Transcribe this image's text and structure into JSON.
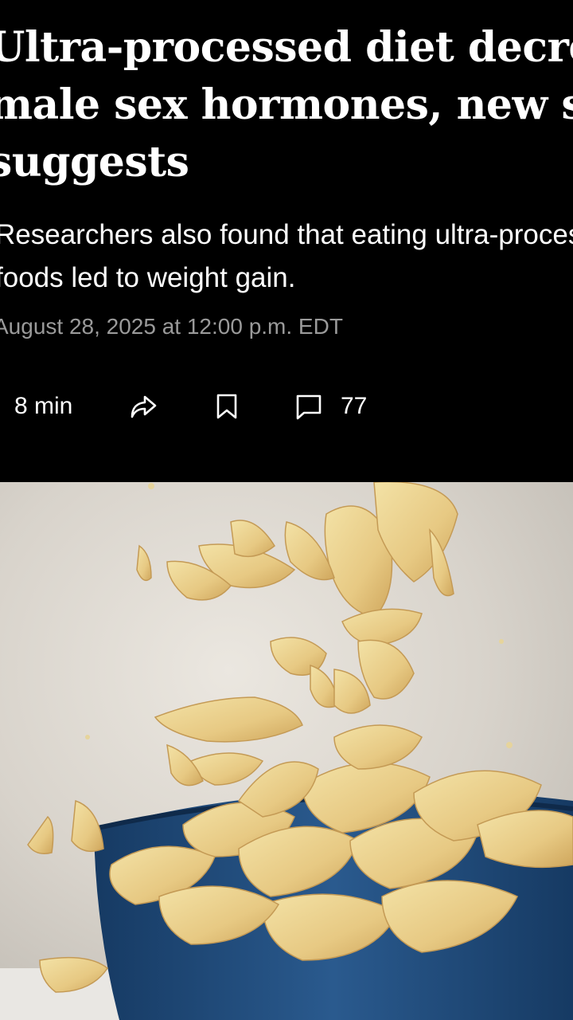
{
  "article": {
    "headline_lines": [
      "Ultra-processed diet decreases",
      "male sex hormones, new study",
      "suggests"
    ],
    "dek_lines": [
      "Researchers also found that eating ultra-processed",
      "foods led to weight gain."
    ],
    "timestamp": "August 28, 2025 at 12:00 p.m. EDT"
  },
  "toolbar": {
    "read_time": "8 min",
    "share_icon": "share-arrow-icon",
    "save_icon": "bookmark-icon",
    "comments_icon": "comment-bubble-icon",
    "comments_count": "77"
  },
  "photo": {
    "subject": "potato chips falling into a blue bowl",
    "bowl_color": "#1f4a7a",
    "background_color": "#d9d4cc",
    "chip_color": "#e9cf8a"
  }
}
